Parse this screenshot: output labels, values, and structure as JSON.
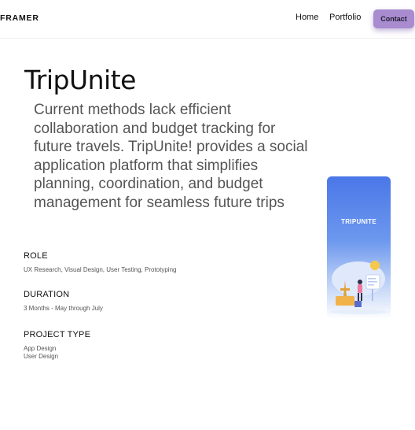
{
  "nav": {
    "brand": "FRAMER",
    "links": [
      "Home",
      "Portfolio"
    ],
    "contact_label": "Contact"
  },
  "hero": {
    "title": "TripUnite",
    "description": "Current methods lack efficient collaboration and budget tracking for future travels. TripUnite! provides a social application platform that simplifies planning, coordination, and budget management for seamless future trips"
  },
  "details": [
    {
      "label": "ROLE",
      "lines": [
        "UX Research, Visual Design, User Testing, Prototyping"
      ]
    },
    {
      "label": "DURATION",
      "lines": [
        "3 Months - May through July"
      ]
    },
    {
      "label": "PROJECT TYPE",
      "lines": [
        "App Design",
        "User Design"
      ]
    }
  ],
  "preview": {
    "app_name": "TRIPUNITE",
    "colors": {
      "top": "#4a77e8",
      "bottom": "#ffffff"
    }
  },
  "colors": {
    "accent": "#a98bd0",
    "text": "#111111",
    "muted": "#555555"
  }
}
